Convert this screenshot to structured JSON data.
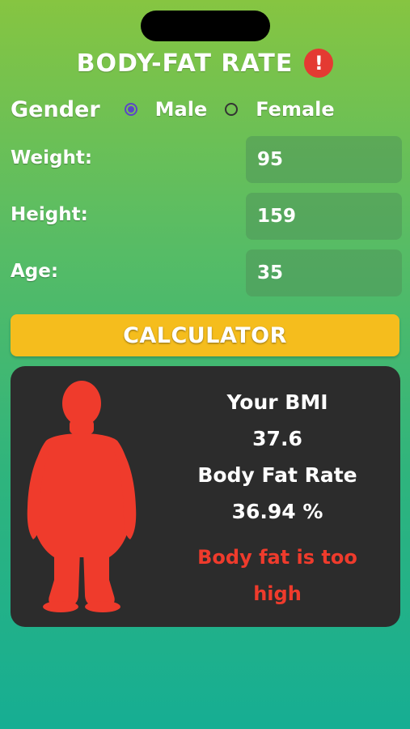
{
  "app": {
    "title": "BODY-FAT RATE",
    "alert_icon": "!"
  },
  "gender": {
    "label": "Gender",
    "options": [
      {
        "label": "Male",
        "selected": true
      },
      {
        "label": "Female",
        "selected": false
      }
    ]
  },
  "fields": {
    "weight": {
      "label": "Weight:",
      "value": "95"
    },
    "height": {
      "label": "Height:",
      "value": "159"
    },
    "age": {
      "label": "Age:",
      "value": "35"
    }
  },
  "calculate_button": {
    "label": "CALCULATOR"
  },
  "result": {
    "bmi_label": "Your BMI",
    "bmi_value": "37.6",
    "bfr_label": "Body Fat Rate",
    "bfr_value": "36.94 %",
    "warning": "Body fat is too high",
    "silhouette_icon": "obese-body-silhouette-icon"
  },
  "colors": {
    "accent_button": "#f5bd1d",
    "warning_text": "#ef3b2c",
    "alert_icon": "#e43a32",
    "card_bg": "#2c2c2c",
    "radio_selected": "#5b46c7"
  }
}
